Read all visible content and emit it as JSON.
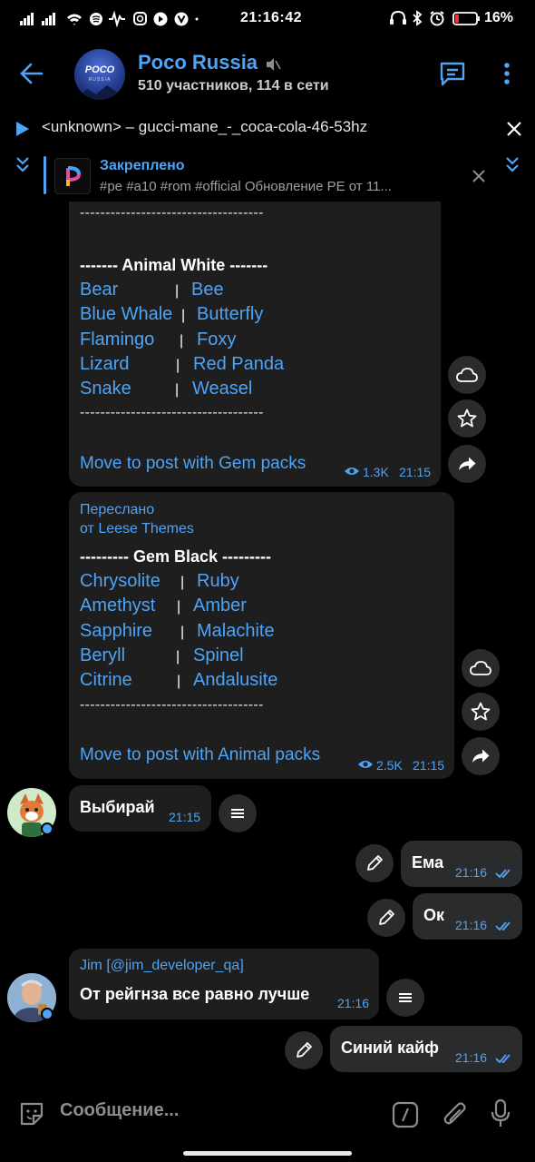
{
  "status_bar": {
    "time": "21:16:42",
    "battery": "16%",
    "icons": [
      "signal-icon",
      "signal-icon",
      "wifi-icon",
      "spotify-icon",
      "audio-icon",
      "instagram-icon",
      "play-icon",
      "v-icon",
      "headphones-icon",
      "bluetooth-icon",
      "alarm-icon",
      "battery-icon"
    ]
  },
  "header": {
    "title": "Poco Russia",
    "subtitle": "510 участников, 114 в сети",
    "avatar_text": "POCO",
    "avatar_subtext": "RUSSIA"
  },
  "audio_player": {
    "track": "<unknown> – gucci-mane_-_coca-cola-46-53hz"
  },
  "pinned": {
    "title": "Закреплено",
    "text": "#pe #a10 #rom #official  Обновление PE от 11..."
  },
  "message1": {
    "dashes": "------------------------------------",
    "section": "------- Animal White -------",
    "rows": [
      {
        "left": "Bear",
        "right": "Bee"
      },
      {
        "left": "Blue Whale",
        "right": "Butterfly"
      },
      {
        "left": "Flamingo",
        "right": "Foxy"
      },
      {
        "left": "Lizard",
        "right": "Red Panda"
      },
      {
        "left": "Snake",
        "right": "Weasel"
      }
    ],
    "separator": "|",
    "link": "Move to post with Gem packs",
    "views": "1.3K",
    "time": "21:15"
  },
  "message2": {
    "forwarded": "Переслано",
    "forwarded_from": "от Leese Themes",
    "section": "--------- Gem Black ---------",
    "dashes": "------------------------------------",
    "rows": [
      {
        "left": "Chrysolite",
        "right": "Ruby"
      },
      {
        "left": "Amethyst",
        "right": "Amber"
      },
      {
        "left": "Sapphire",
        "right": "Malachite"
      },
      {
        "left": "Beryll",
        "right": "Spinel"
      },
      {
        "left": "Citrine",
        "right": "Andalusite"
      }
    ],
    "separator": "|",
    "link": "Move to post with Animal packs",
    "views": "2.5K",
    "time": "21:15"
  },
  "message3": {
    "text": "Выбирай",
    "time": "21:15"
  },
  "message4": {
    "text": "Ема",
    "time": "21:16"
  },
  "message5": {
    "text": "Ок",
    "time": "21:16"
  },
  "message6": {
    "author": "Jim [@jim_developer_qa]",
    "text": "От рейгнза все равно лучше",
    "time": "21:16"
  },
  "message7": {
    "text": "Синий кайф",
    "time": "21:16"
  },
  "composer": {
    "placeholder": "Сообщение..."
  },
  "colors": {
    "accent": "#4ea4f6",
    "bubble": "#1e1e1f",
    "background": "#000000"
  }
}
